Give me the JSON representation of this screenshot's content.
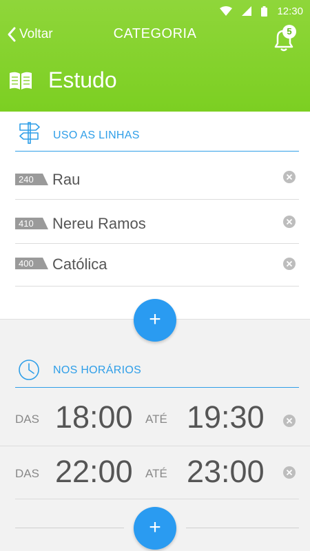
{
  "status_bar": {
    "time": "12:30"
  },
  "nav": {
    "back_label": "Voltar",
    "title": "CATEGORIA",
    "notification_count": "5"
  },
  "category": {
    "title": "Estudo",
    "icon": "book-icon"
  },
  "lines_section": {
    "heading": "USO AS LINHAS",
    "icon": "signpost-icon",
    "items": [
      {
        "number": "240",
        "name": "Rau"
      },
      {
        "number": "410",
        "name": "Nereu Ramos"
      },
      {
        "number": "400",
        "name": "Católica"
      }
    ],
    "add_label": "+"
  },
  "times_section": {
    "heading": "NOS HORÁRIOS",
    "icon": "clock-icon",
    "items": [
      {
        "from_label": "DAS",
        "from": "18:00",
        "to_label": "ATÉ",
        "to": "19:30"
      },
      {
        "from_label": "DAS",
        "from": "22:00",
        "to_label": "ATÉ",
        "to": "23:00"
      }
    ],
    "add_label": "+"
  },
  "colors": {
    "accent_green": "#7ccf22",
    "accent_blue": "#2a9bf1",
    "text_gray": "#555555"
  }
}
